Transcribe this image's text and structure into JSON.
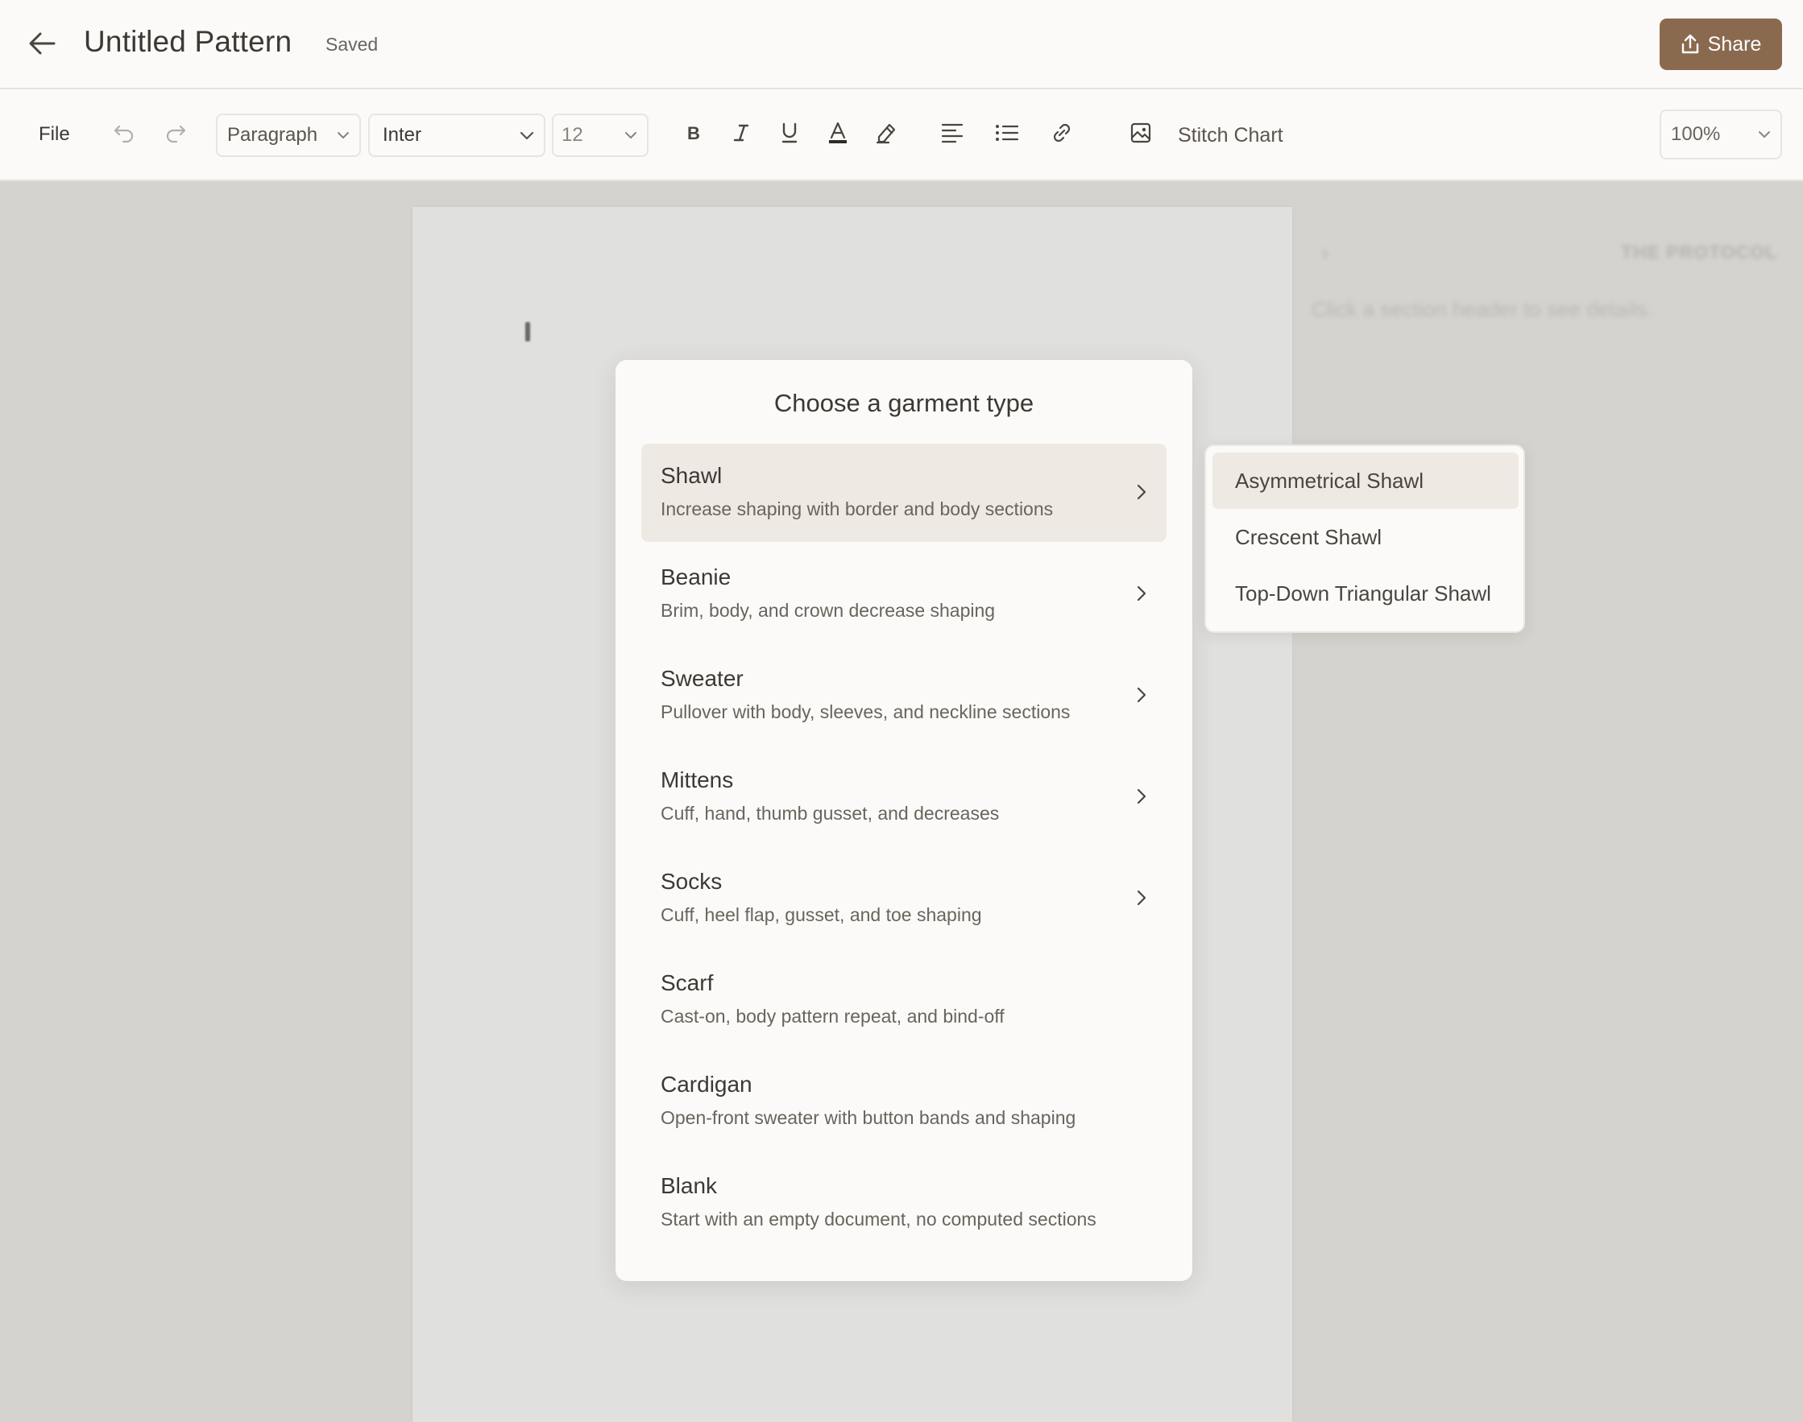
{
  "header": {
    "title": "Untitled Pattern",
    "status": "Saved",
    "share_label": "Share"
  },
  "toolbar": {
    "file_label": "File",
    "block_style": "Paragraph",
    "font": "Inter",
    "font_size": "12",
    "stitch_chart_label": "Stitch Chart",
    "zoom": "100%"
  },
  "side_panel": {
    "title": "THE PROTOCOL",
    "hint": "Click a section header to see details."
  },
  "modal": {
    "title": "Choose a garment type",
    "options": [
      {
        "name": "Shawl",
        "desc": "Increase shaping with border and body sections",
        "has_submenu": true
      },
      {
        "name": "Beanie",
        "desc": "Brim, body, and crown decrease shaping",
        "has_submenu": true
      },
      {
        "name": "Sweater",
        "desc": "Pullover with body, sleeves, and neckline sections",
        "has_submenu": true
      },
      {
        "name": "Mittens",
        "desc": "Cuff, hand, thumb gusset, and decreases",
        "has_submenu": true
      },
      {
        "name": "Socks",
        "desc": "Cuff, heel flap, gusset, and toe shaping",
        "has_submenu": true
      },
      {
        "name": "Scarf",
        "desc": "Cast-on, body pattern repeat, and bind-off",
        "has_submenu": false
      },
      {
        "name": "Cardigan",
        "desc": "Open-front sweater with button bands and shaping",
        "has_submenu": false
      },
      {
        "name": "Blank",
        "desc": "Start with an empty document, no computed sections",
        "has_submenu": false
      }
    ]
  },
  "submenu": {
    "items": [
      "Asymmetrical Shawl",
      "Crescent Shawl",
      "Top-Down Triangular Shawl"
    ]
  },
  "colors": {
    "accent": "#8a6a4f",
    "active_bg": "#eee9e3",
    "backdrop": "#d5d3cf"
  }
}
